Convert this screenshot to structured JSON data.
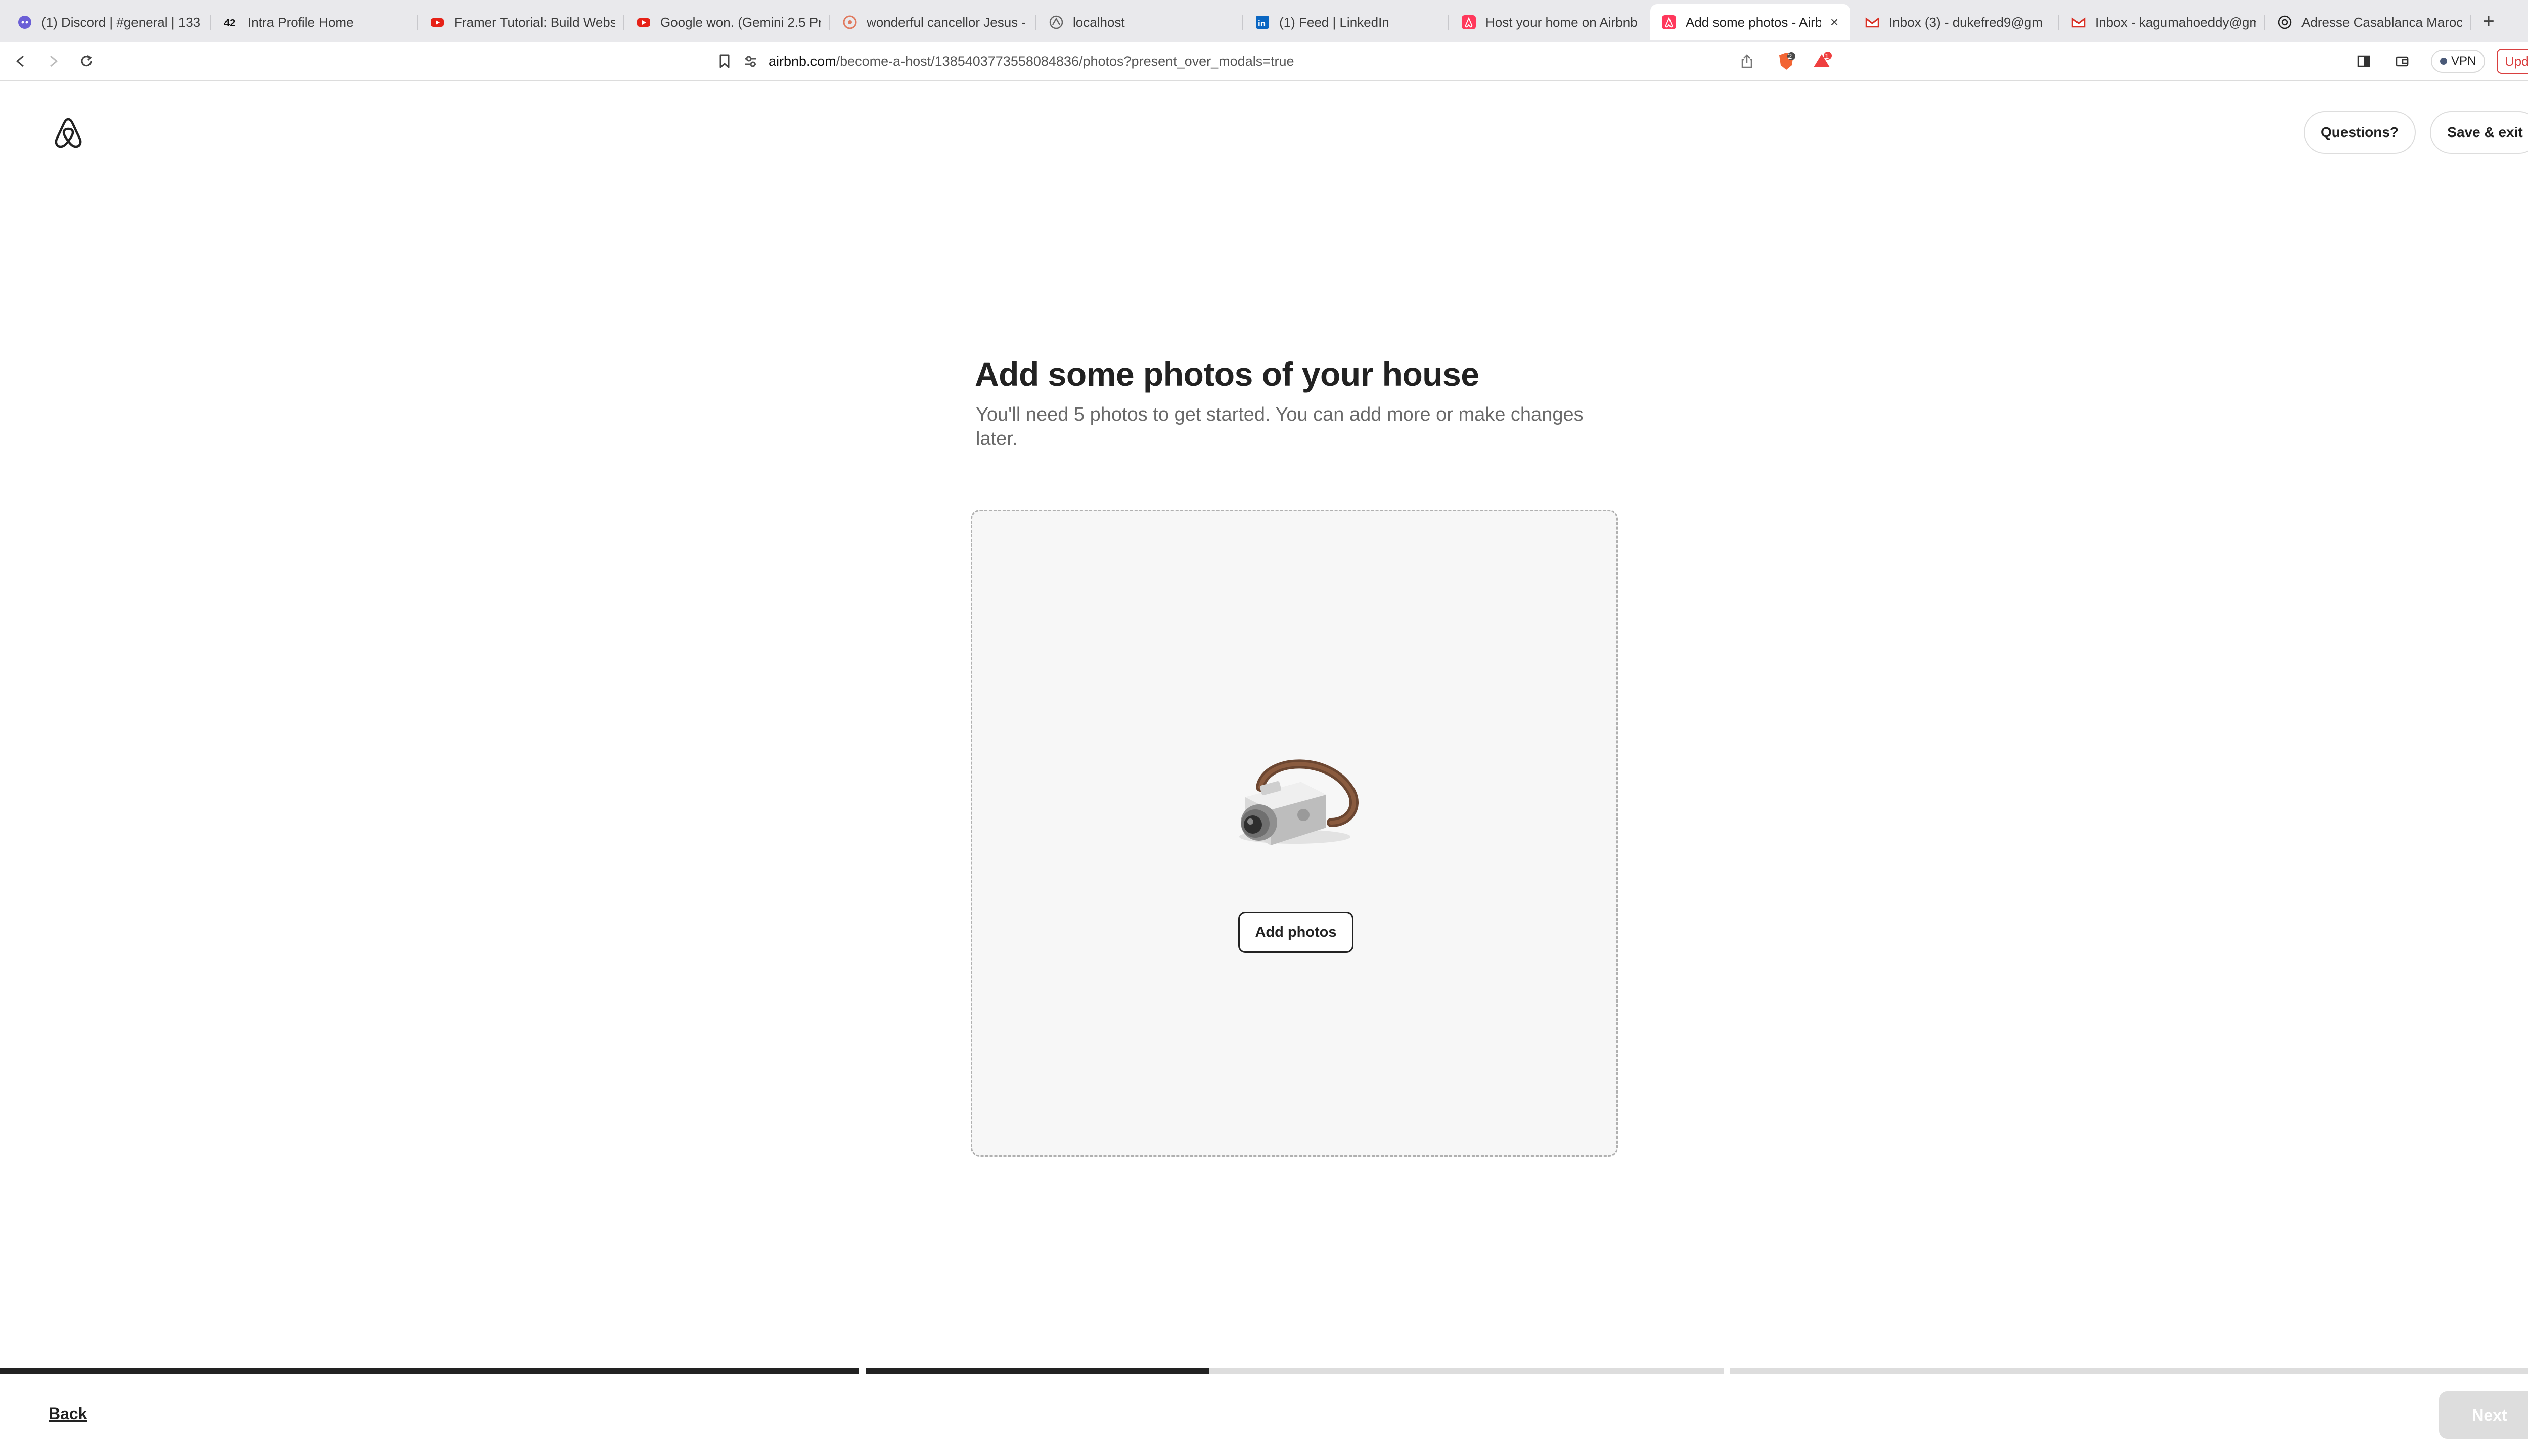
{
  "browser": {
    "tabs": [
      {
        "title": "(1) Discord | #general | 133",
        "icon": "discord-icon"
      },
      {
        "title": "Intra Profile Home",
        "icon": "42-icon"
      },
      {
        "title": "Framer Tutorial: Build Webs",
        "icon": "youtube-icon"
      },
      {
        "title": "Google won. (Gemini 2.5 Pr",
        "icon": "youtube-icon"
      },
      {
        "title": "wonderful cancellor Jesus -",
        "icon": "chat-icon"
      },
      {
        "title": "localhost",
        "icon": "globe-icon"
      },
      {
        "title": "(1) Feed | LinkedIn",
        "icon": "linkedin-icon"
      },
      {
        "title": "Host your home on Airbnb",
        "icon": "airbnb-icon"
      },
      {
        "title": "Add some photos - Airb",
        "icon": "airbnb-icon",
        "active": true
      },
      {
        "title": "Inbox (3) - dukefred9@gm",
        "icon": "gmail-icon"
      },
      {
        "title": "Inbox - kagumahoeddy@gm",
        "icon": "gmail-icon"
      },
      {
        "title": "Adresse Casablanca Maroc",
        "icon": "openai-icon"
      }
    ],
    "url_host": "airbnb.com",
    "url_path": "/become-a-host/1385403773558084836/photos?present_over_modals=true",
    "shields_count": "2",
    "rewards_count": "1",
    "vpn_label": "VPN",
    "update_label": "Update"
  },
  "header": {
    "questions_label": "Questions?",
    "save_exit_label": "Save & exit"
  },
  "main": {
    "title": "Add some photos of your house",
    "subtitle": "You'll need 5 photos to get started. You can add more or make changes later.",
    "add_photos_label": "Add photos"
  },
  "progress": {
    "segments": [
      1.0,
      0.4,
      0.0
    ]
  },
  "footer": {
    "back_label": "Back",
    "next_label": "Next"
  },
  "colors": {
    "airbnb_brand": "#222222",
    "progress_fill": "#222222",
    "progress_track": "#dddddd",
    "update_red": "#d93f3f"
  }
}
